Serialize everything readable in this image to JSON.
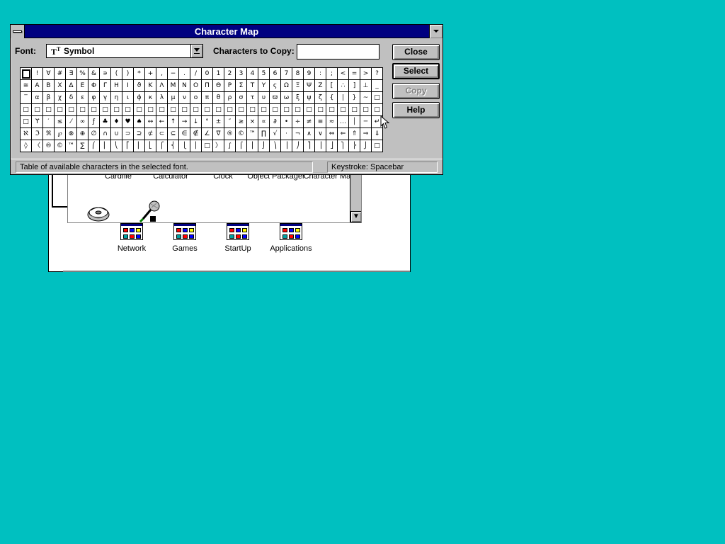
{
  "window": {
    "title": "Character Map"
  },
  "font": {
    "label": "Font:",
    "value": "Symbol",
    "type_glyph": "T"
  },
  "copy": {
    "label": "Characters to Copy:",
    "value": ""
  },
  "buttons": {
    "close": "Close",
    "select": "Select",
    "copy": "Copy",
    "help": "Help"
  },
  "grid": {
    "rows": [
      [
        " ",
        "!",
        "∀",
        "#",
        "∃",
        "%",
        "&",
        "∍",
        "(",
        ")",
        "*",
        "+",
        ",",
        "−",
        ".",
        "/",
        "0",
        "1",
        "2",
        "3",
        "4",
        "5",
        "6",
        "7",
        "8",
        "9",
        ":",
        ";",
        "<",
        "=",
        ">",
        "?"
      ],
      [
        "≅",
        "Α",
        "Β",
        "Χ",
        "Δ",
        "Ε",
        "Φ",
        "Γ",
        "Η",
        "Ι",
        "ϑ",
        "Κ",
        "Λ",
        "Μ",
        "Ν",
        "Ο",
        "Π",
        "Θ",
        "Ρ",
        "Σ",
        "Τ",
        "Υ",
        "ς",
        "Ω",
        "Ξ",
        "Ψ",
        "Ζ",
        "[",
        "∴",
        "]",
        "⊥",
        "_"
      ],
      [
        "‾",
        "α",
        "β",
        "χ",
        "δ",
        "ε",
        "φ",
        "γ",
        "η",
        "ι",
        "ϕ",
        "κ",
        "λ",
        "μ",
        "ν",
        "ο",
        "π",
        "θ",
        "ρ",
        "σ",
        "τ",
        "υ",
        "ϖ",
        "ω",
        "ξ",
        "ψ",
        "ζ",
        "{",
        "|",
        "}",
        "~",
        "□"
      ],
      [
        "□",
        "□",
        "□",
        "□",
        "□",
        "□",
        "□",
        "□",
        "□",
        "□",
        "□",
        "□",
        "□",
        "□",
        "□",
        "□",
        "□",
        "□",
        "□",
        "□",
        "□",
        "□",
        "□",
        "□",
        "□",
        "□",
        "□",
        "□",
        "□",
        "□",
        "□",
        "□"
      ],
      [
        "□",
        "ϒ",
        "′",
        "≤",
        "⁄",
        "∞",
        "ƒ",
        "♣",
        "♦",
        "♥",
        "♠",
        "↔",
        "←",
        "↑",
        "→",
        "↓",
        "°",
        "±",
        "″",
        "≥",
        "×",
        "∝",
        "∂",
        "•",
        "÷",
        "≠",
        "≡",
        "≈",
        "…",
        "│",
        "─",
        "↵"
      ],
      [
        "ℵ",
        "ℑ",
        "ℜ",
        "℘",
        "⊗",
        "⊕",
        "∅",
        "∩",
        "∪",
        "⊃",
        "⊇",
        "⊄",
        "⊂",
        "⊆",
        "∈",
        "∉",
        "∠",
        "∇",
        "®",
        "©",
        "™",
        "∏",
        "√",
        "⋅",
        "¬",
        "∧",
        "∨",
        "⇔",
        "⇐",
        "⇑",
        "⇒",
        "⇓"
      ],
      [
        "◊",
        "〈",
        "®",
        "©",
        "™",
        "∑",
        "⎛",
        "⎜",
        "⎝",
        "⎡",
        "⎢",
        "⎣",
        "⎧",
        "⎨",
        "⎩",
        "⎪",
        "□",
        "〉",
        "∫",
        "⌠",
        "⎮",
        "⌡",
        "⎞",
        "⎟",
        "⎠",
        "⎤",
        "⎥",
        "⎦",
        "⎫",
        "⎬",
        "⎭",
        "□"
      ]
    ]
  },
  "status": {
    "hint": "Table of available characters in the selected font.",
    "keystroke": "Keystroke: Spacebar"
  },
  "background": {
    "accessories_labels": [
      "Cardfile",
      "Calculator",
      "Clock",
      "Object Packager",
      "Character Map"
    ],
    "groups": [
      "Network",
      "Games",
      "StartUp",
      "Applications"
    ]
  },
  "colors": {
    "desktop": "#00c0c0",
    "title_active": "#000080",
    "face": "#c0c0c0"
  }
}
